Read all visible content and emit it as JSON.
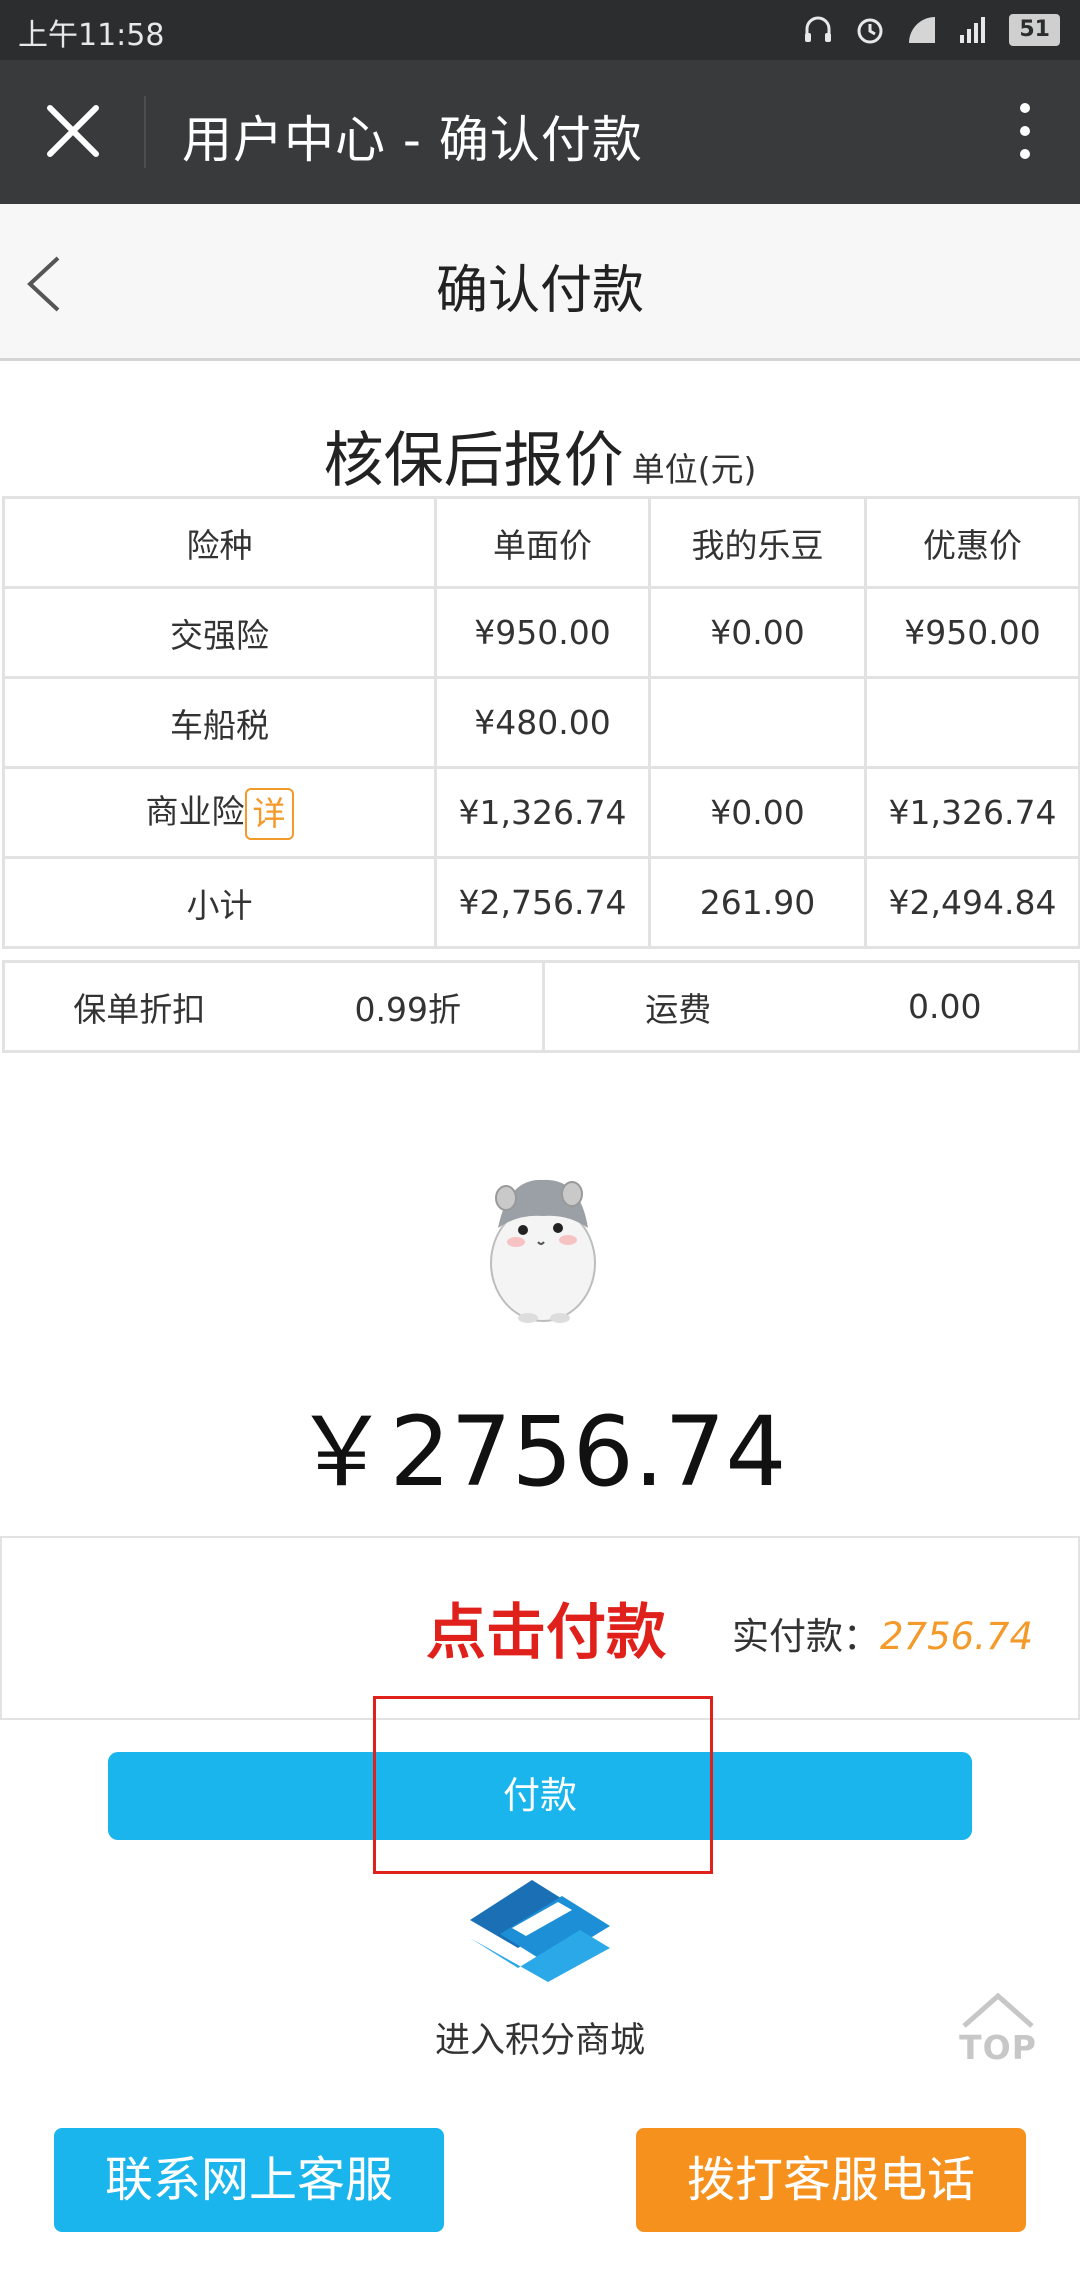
{
  "status_bar": {
    "time": "上午11:58",
    "battery": "51",
    "icons": [
      "headset-icon",
      "alarm-icon",
      "wifi-icon",
      "signal-icon",
      "battery-icon"
    ]
  },
  "titlebar": {
    "title": "用户中心 - 确认付款",
    "close_icon": "close-icon",
    "more_icon": "more-vertical-icon"
  },
  "page_header": {
    "title": "确认付款",
    "back_icon": "back-chevron-icon"
  },
  "quote": {
    "title": "核保后报价",
    "unit": "单位(元)",
    "headers": [
      "险种",
      "单面价",
      "我的乐豆",
      "优惠价"
    ],
    "rows": [
      {
        "type": "交强险",
        "price": "¥950.00",
        "ledou": "¥0.00",
        "discount": "¥950.00"
      },
      {
        "type": "车船税",
        "price": "¥480.00",
        "ledou": "",
        "discount": ""
      },
      {
        "type": "商业险",
        "detail": "详",
        "price": "¥1,326.74",
        "ledou": "¥0.00",
        "discount": "¥1,326.74"
      },
      {
        "type": "小计",
        "price": "¥2,756.74",
        "ledou": "261.90",
        "discount": "¥2,494.84"
      }
    ],
    "footer": {
      "policy_discount_label": "保单折扣",
      "policy_discount_value": "0.99折",
      "shipping_label": "运费",
      "shipping_value": "0.00"
    }
  },
  "payment": {
    "total_display": "￥2756.74",
    "click_hint": "点击付款",
    "actual_label": "实付款：",
    "actual_amount": "2756.74",
    "pay_button": "付款"
  },
  "shop": {
    "label": "进入积分商城"
  },
  "top_button": {
    "label": "TOP"
  },
  "bottom": {
    "contact_online": "联系网上客服",
    "call_service": "拨打客服电话"
  },
  "colors": {
    "accent_blue": "#19b5ec",
    "accent_orange": "#f7911d",
    "hint_red": "#e0201a",
    "amount_orange": "#f39a2b"
  }
}
